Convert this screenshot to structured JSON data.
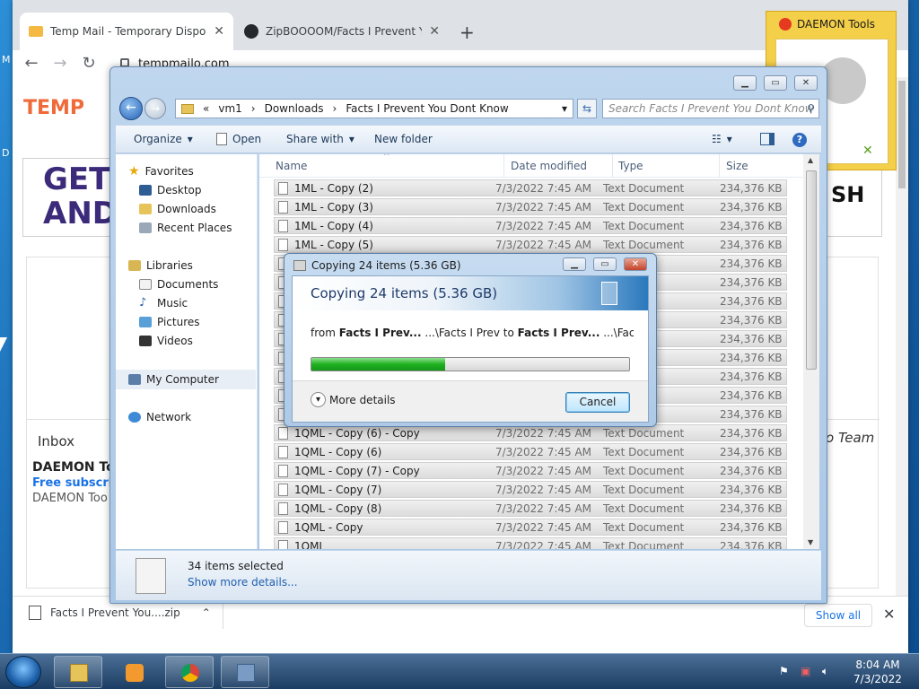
{
  "desktop": {
    "letters": [
      "M",
      "D"
    ]
  },
  "chrome": {
    "tabs": [
      {
        "title": "Temp Mail - Temporary Disposab",
        "icon": "envelope-icon",
        "active": true
      },
      {
        "title": "ZipBOOOOM/Facts I Prevent You",
        "icon": "github-icon",
        "active": false
      }
    ],
    "new_tab": "+",
    "url": "tempmailo.com",
    "site": {
      "logo": "TEMP",
      "banner_left": "GET\nAND",
      "banner_right": "SH",
      "inbox_label": "Inbox",
      "team_label": "o Team",
      "mail": {
        "from": "DAEMON To",
        "subject": "Free subscript",
        "preview": "DAEMON Too"
      }
    },
    "downloads": {
      "file": "Facts I Prevent You....zip",
      "show_all": "Show all"
    }
  },
  "daemon_popup": {
    "title": "DAEMON Tools"
  },
  "explorer": {
    "breadcrumb": [
      "«",
      "vm1",
      "Downloads",
      "Facts I Prevent You Dont Know"
    ],
    "search_placeholder": "Search Facts I Prevent You Dont Know",
    "commands": {
      "organize": "Organize",
      "open": "Open",
      "share_with": "Share with",
      "new_folder": "New folder"
    },
    "nav": {
      "favorites": "Favorites",
      "favorite_items": [
        "Desktop",
        "Downloads",
        "Recent Places"
      ],
      "libraries": "Libraries",
      "library_items": [
        "Documents",
        "Music",
        "Pictures",
        "Videos"
      ],
      "my_computer": "My Computer",
      "network": "Network"
    },
    "columns": {
      "name": "Name",
      "date": "Date modified",
      "type": "Type",
      "size": "Size"
    },
    "files": [
      {
        "name": "1ML - Copy (2)",
        "date": "7/3/2022 7:45 AM",
        "type": "Text Document",
        "size": "234,376 KB"
      },
      {
        "name": "1ML - Copy (3)",
        "date": "7/3/2022 7:45 AM",
        "type": "Text Document",
        "size": "234,376 KB"
      },
      {
        "name": "1ML - Copy (4)",
        "date": "7/3/2022 7:45 AM",
        "type": "Text Document",
        "size": "234,376 KB"
      },
      {
        "name": "1ML - Copy (5)",
        "date": "7/3/2022 7:45 AM",
        "type": "Text Document",
        "size": "234,376 KB"
      },
      {
        "name": "",
        "date": "",
        "type": "ocument",
        "size": "234,376 KB"
      },
      {
        "name": "",
        "date": "",
        "type": "ocument",
        "size": "234,376 KB"
      },
      {
        "name": "",
        "date": "",
        "type": "ocument",
        "size": "234,376 KB"
      },
      {
        "name": "",
        "date": "",
        "type": "ocument",
        "size": "234,376 KB"
      },
      {
        "name": "",
        "date": "",
        "type": "ocument",
        "size": "234,376 KB"
      },
      {
        "name": "",
        "date": "",
        "type": "ocument",
        "size": "234,376 KB"
      },
      {
        "name": "",
        "date": "",
        "type": "ocument",
        "size": "234,376 KB"
      },
      {
        "name": "",
        "date": "",
        "type": "ocument",
        "size": "234,376 KB"
      },
      {
        "name": "",
        "date": "",
        "type": "ocument",
        "size": "234,376 KB"
      },
      {
        "name": "1QML - Copy (6) - Copy",
        "date": "7/3/2022 7:45 AM",
        "type": "Text Document",
        "size": "234,376 KB"
      },
      {
        "name": "1QML - Copy (6)",
        "date": "7/3/2022 7:45 AM",
        "type": "Text Document",
        "size": "234,376 KB"
      },
      {
        "name": "1QML - Copy (7) - Copy",
        "date": "7/3/2022 7:45 AM",
        "type": "Text Document",
        "size": "234,376 KB"
      },
      {
        "name": "1QML - Copy (7)",
        "date": "7/3/2022 7:45 AM",
        "type": "Text Document",
        "size": "234,376 KB"
      },
      {
        "name": "1QML - Copy (8)",
        "date": "7/3/2022 7:45 AM",
        "type": "Text Document",
        "size": "234,376 KB"
      },
      {
        "name": "1QML - Copy",
        "date": "7/3/2022 7:45 AM",
        "type": "Text Document",
        "size": "234,376 KB"
      },
      {
        "name": "1QML",
        "date": "7/3/2022 7:45 AM",
        "type": "Text Document",
        "size": "234,376 KB"
      }
    ],
    "details": {
      "selected": "34 items selected",
      "more": "Show more details..."
    }
  },
  "copy_dialog": {
    "title": "Copying 24 items (5.36 GB)",
    "heading": "Copying 24 items (5.36 GB)",
    "from_word": "from",
    "source_bold": "Facts I Prev...",
    "source_path": "...\\Facts I Prev",
    "to_word": "to",
    "dest_bold": "Facts I Prev...",
    "dest_path": "...\\Facts I Prev",
    "progress": 0.42,
    "more_details": "More details",
    "cancel": "Cancel"
  },
  "taskbar": {
    "apps": [
      "windows-explorer-icon",
      "media-player-icon",
      "chrome-icon",
      "network-app-icon"
    ],
    "time": "8:04 AM",
    "date": "7/3/2022"
  }
}
